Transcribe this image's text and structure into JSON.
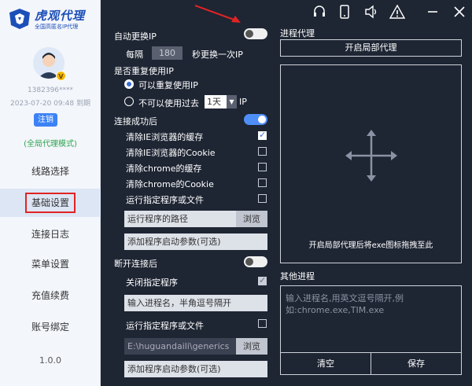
{
  "sidebar": {
    "brand_title": "虎观代理",
    "brand_subtitle": "全国高匿名IP代理",
    "vip_badge": "V",
    "user_phone": "1382396****",
    "user_expire": "2023-07-20 09:48 到期",
    "logout_label": "注销",
    "mode_label": "(全局代理模式)",
    "nav": [
      {
        "label": "线路选择"
      },
      {
        "label": "基础设置"
      },
      {
        "label": "连接日志"
      },
      {
        "label": "菜单设置"
      },
      {
        "label": "充值续费"
      },
      {
        "label": "账号绑定"
      }
    ],
    "version": "1.0.0"
  },
  "settings": {
    "auto_switch_label": "自动更换IP",
    "every_label": "每隔",
    "interval_value": "180",
    "interval_suffix": "秒更换一次IP",
    "reuse_label": "是否重复使用IP",
    "reuse_option_1": "可以重复使用IP",
    "reuse_option_2": "不可以使用过去",
    "reuse_period": "1天",
    "reuse_suffix": "IP",
    "on_connect_label": "连接成功后",
    "clear_ie_cache": "清除IE浏览器的缓存",
    "clear_ie_cookie": "清除IE浏览器的Cookie",
    "clear_chrome_cache": "清除chrome的缓存",
    "clear_chrome_cookie": "清除chrome的Cookie",
    "run_program_1": "运行指定程序或文件",
    "program_path_placeholder": "运行程序的路径",
    "browse_label_1": "浏览",
    "add_params_1": "添加程序启动参数(可选)",
    "on_disconnect_label": "断开连接后",
    "close_program": "关闭指定程序",
    "process_input_placeholder": "输入进程名，半角逗号隔开",
    "run_program_2": "运行指定程序或文件",
    "program_path_value": "E:\\huguandaili\\generics",
    "browse_label_2": "浏览",
    "add_params_2": "添加程序启动参数(可选)"
  },
  "proxy": {
    "section_label": "进程代理",
    "enable_button": "开启局部代理",
    "drop_hint": "开启局部代理后将exe图标拖拽至此",
    "other_label": "其他进程",
    "other_placeholder": "输入进程名,用英文逗号隔开,例如:chrome.exe,TIM.exe",
    "clear_button": "清空",
    "save_button": "保存"
  },
  "titlebar": {
    "icons": [
      "headset-icon",
      "tablet-icon",
      "volume-icon",
      "warning-icon",
      "minimize-icon",
      "close-icon"
    ]
  },
  "colors": {
    "panel_bg": "#1e2533",
    "sidebar_bg": "#f3f6fb",
    "accent": "#4e8ff7",
    "annotation_red": "#e02424"
  }
}
